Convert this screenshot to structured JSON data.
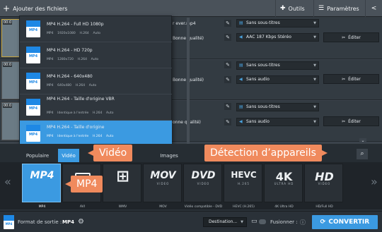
{
  "topbar": {
    "add_files": "Ajouter des fichiers",
    "tools": "Outils",
    "settings": "Paramètres"
  },
  "files": [
    {
      "timecode": "00:0",
      "name": "r ever.mp4",
      "quality": "Bonne qualité)",
      "subtitles": "Sans sous-titres",
      "audio": "AAC 187 Kbps Stéréo",
      "edit": "Éditer"
    },
    {
      "timecode": "00:0",
      "name": "",
      "quality": "Bonne qualité)",
      "subtitles": "Sans sous-titres",
      "audio": "Sans audio",
      "edit": "Éditer"
    },
    {
      "timecode": "00:0",
      "name": "",
      "quality": "onne qualité)",
      "subtitles": "Sans sous-titres",
      "audio": "Sans audio",
      "edit": "Éditer"
    }
  ],
  "dropdown": {
    "items": [
      {
        "icon_label": "MP4",
        "title": "MP4 H.264 - Full HD 1080p",
        "sub": "MP4    1920x1080    H.264    Auto"
      },
      {
        "icon_label": "MP4",
        "title": "MP4 H.264 - HD 720p",
        "sub": "MP4    1280x720    H.264    Auto"
      },
      {
        "icon_label": "MP4",
        "title": "MP4 H.264 - 640x480",
        "sub": "MP4    640x480    H.264    Auto"
      },
      {
        "icon_label": "MP4",
        "title": "MP4 H.264 - Taille d'origine VBR",
        "sub": "MP4    Identique à l'entrée    H.264    Auto"
      },
      {
        "icon_label": "MP4",
        "title": "MP4 H.264 - Taille d'origine",
        "sub": "MP4    Identique à l'entrée    H.264    Auto"
      }
    ]
  },
  "tabs": {
    "popular": "Populaire",
    "video": "Vidéo",
    "images": "Images"
  },
  "formats": [
    {
      "logo": "MP4",
      "sub": "",
      "caption": "MP4"
    },
    {
      "logo": "",
      "sub": "",
      "caption": "AVI"
    },
    {
      "logo": "",
      "sub": "",
      "caption": "WMV"
    },
    {
      "logo": "MOV",
      "sub": "VIDEO",
      "caption": "MOV"
    },
    {
      "logo": "DVD",
      "sub": "VIDEO",
      "caption": "Vidéo compatible - DVD"
    },
    {
      "logo": "HEVC",
      "sub": "H.265",
      "caption": "HEVC (H.265)"
    },
    {
      "logo": "4K",
      "sub": "ULTRA HD",
      "caption": "4K Ultra HD"
    },
    {
      "logo": "HD",
      "sub": "VIDEO",
      "caption": "HD/Full HD"
    }
  ],
  "callouts": {
    "video": "Vidéo",
    "devices": "Détection d’appareils",
    "mp4": "MP4"
  },
  "bottombar": {
    "output_label": "Format de sortie :",
    "output_value": "MP4",
    "destination": "Destination...",
    "merge": "Fusionner :",
    "convert": "CONVERTIR"
  },
  "colors": {
    "accent": "#3b9ae1",
    "callout": "#f08a5d"
  }
}
